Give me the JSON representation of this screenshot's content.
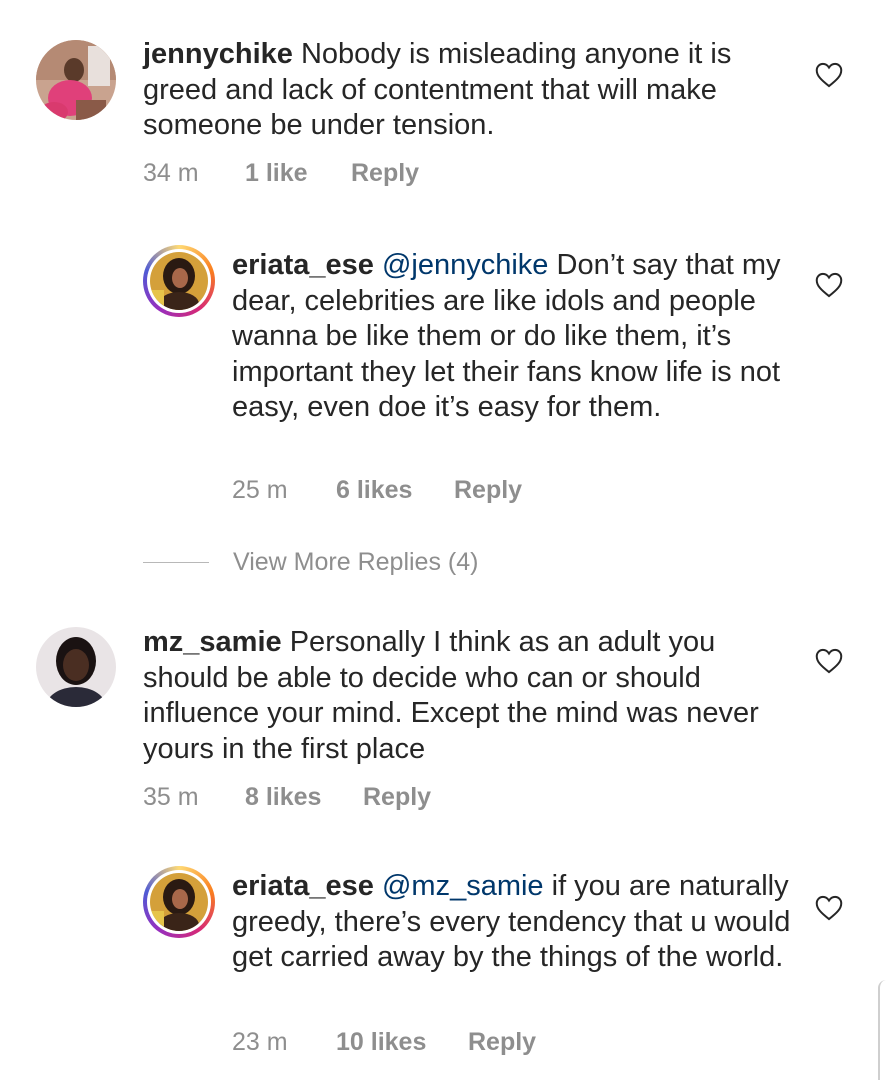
{
  "comments": [
    {
      "username": "jennychike",
      "text": "Nobody is misleading anyone it is greed and lack of contentment that will make someone be under tension.",
      "time": "34 m",
      "likes": "1 like",
      "reply": "Reply",
      "avatar": "avatar-photo-woman-pink-outfit"
    },
    {
      "username": "eriata_ese",
      "mention": "@jennychike",
      "text": "Don’t say that my dear, celebrities are like idols and people wanna be like them or do like them, it’s important they let their fans know life is not easy, even doe it’s easy for them.",
      "time": "25 m",
      "likes": "6 likes",
      "reply": "Reply",
      "avatar": "avatar-photo-woman-story-ring"
    },
    {
      "username": "mz_samie",
      "text": "Personally I think as an adult you should be able to decide who can or should influence your mind. Except the mind was never yours in the first place",
      "time": "35 m",
      "likes": "8 likes",
      "reply": "Reply",
      "avatar": "avatar-photo-woman-dark"
    },
    {
      "username": "eriata_ese",
      "mention": "@mz_samie",
      "text": "if you are naturally greedy, there’s every tendency that u would get carried away by the things of the world.",
      "time": "23 m",
      "likes": "10 likes",
      "reply": "Reply",
      "avatar": "avatar-photo-woman-story-ring"
    }
  ],
  "view_more_replies": "View More Replies (4)",
  "colors": {
    "text": "#262626",
    "meta": "#8e8e8e",
    "mention": "#00376b",
    "background": "#ffffff"
  },
  "icons": {
    "like": "heart-outline-icon"
  }
}
